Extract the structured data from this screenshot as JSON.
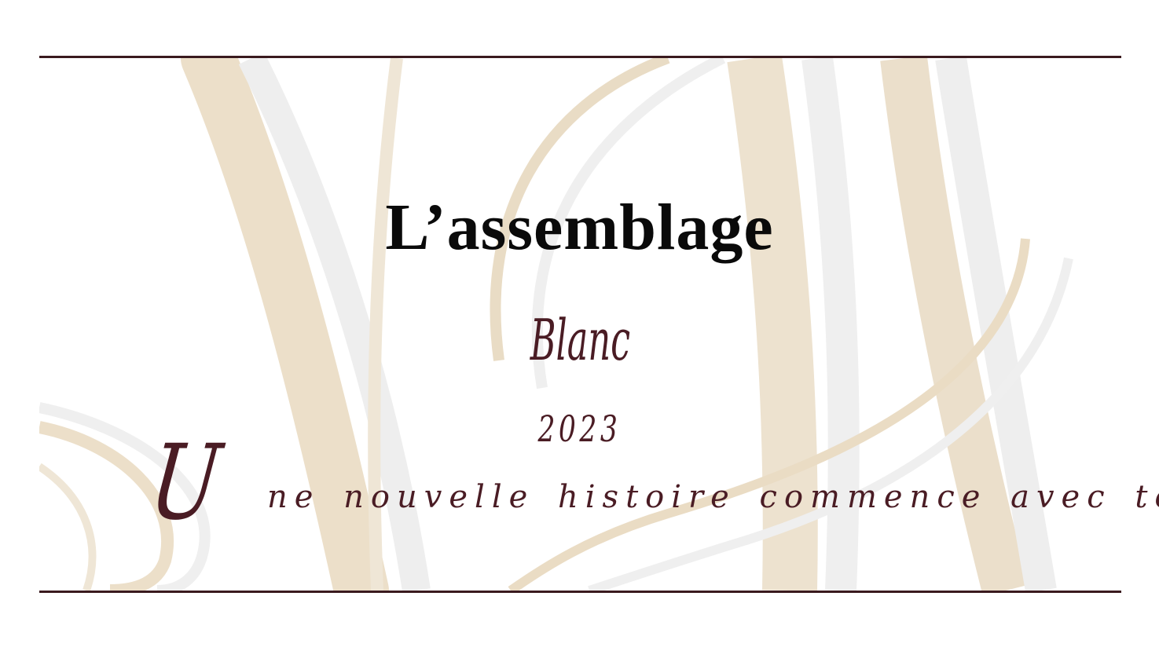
{
  "label": {
    "title": "L’assemblage",
    "variety": "Blanc",
    "vintage": "2023",
    "tagline_first": "U",
    "tagline_rest": "ne nouvelle histoire commence avec toi"
  },
  "colors": {
    "rule": "#3a1a1e",
    "script": "#4a1c24",
    "title": "#0a0a0a",
    "deco_beige": "#ecdfc9",
    "deco_grey": "#ececec"
  }
}
